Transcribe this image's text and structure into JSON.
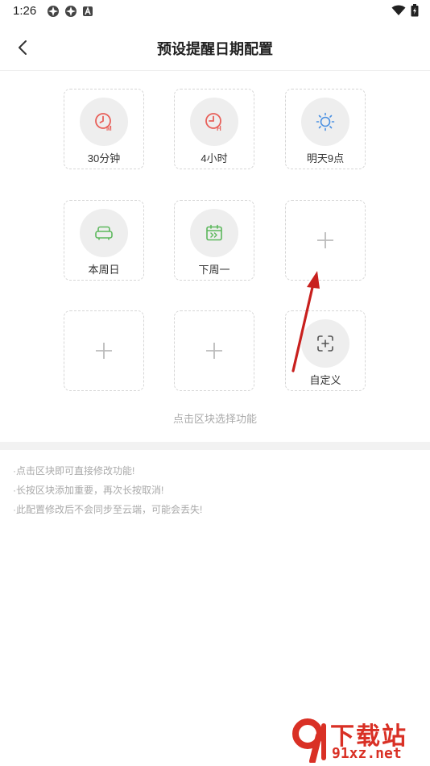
{
  "status_bar": {
    "time": "1:26",
    "left_icons": [
      "notification-app-icon",
      "notification-app-icon",
      "notification-a-icon"
    ],
    "right_icons": [
      "wifi-icon",
      "battery-charging-icon"
    ]
  },
  "nav": {
    "title": "预设提醒日期配置",
    "back_icon": "chevron-left-icon"
  },
  "tiles": [
    {
      "label": "30分钟",
      "icon": "clock-m-icon",
      "color": "#e8605a",
      "empty": false
    },
    {
      "label": "4小时",
      "icon": "clock-h-icon",
      "color": "#e8605a",
      "empty": false
    },
    {
      "label": "明天9点",
      "icon": "sun-icon",
      "color": "#4a90e2",
      "empty": false
    },
    {
      "label": "本周日",
      "icon": "sofa-icon",
      "color": "#5cb85c",
      "empty": false
    },
    {
      "label": "下周一",
      "icon": "calendar-next-icon",
      "color": "#5cb85c",
      "empty": false
    },
    {
      "label": "",
      "icon": "plus-icon",
      "color": "#bbbbbb",
      "empty": true
    },
    {
      "label": "",
      "icon": "plus-icon",
      "color": "#bbbbbb",
      "empty": true
    },
    {
      "label": "",
      "icon": "plus-icon",
      "color": "#bbbbbb",
      "empty": true
    },
    {
      "label": "自定义",
      "icon": "custom-add-icon",
      "color": "#555555",
      "empty": false
    }
  ],
  "hint": "点击区块选择功能",
  "notes": [
    "·点击区块即可直接修改功能!",
    "·长按区块添加重要，再次长按取消!",
    "·此配置修改后不会同步至云端，可能会丢失!"
  ],
  "watermark": {
    "top": "下载站",
    "bottom": "91xz.net"
  }
}
